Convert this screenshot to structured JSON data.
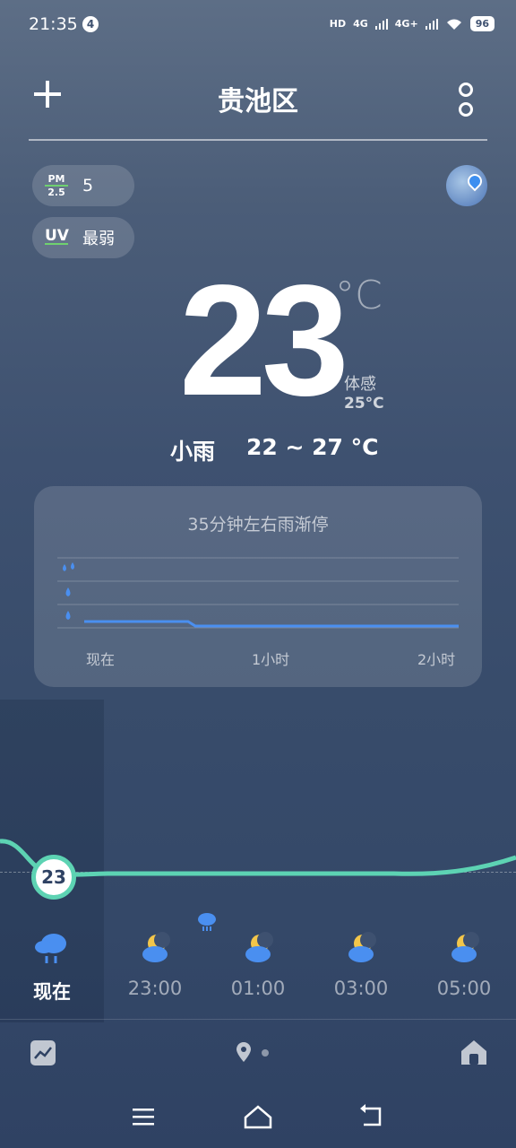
{
  "status_bar": {
    "time": "21:35",
    "notification_count": "4",
    "network_1": "4G",
    "network_2": "4G+",
    "battery": "96"
  },
  "header": {
    "title": "贵池区",
    "add_icon": "plus-icon",
    "menu_icon": "more-vertical-icon"
  },
  "indicators": {
    "pm_label_top": "PM",
    "pm_label_bottom": "2.5",
    "pm_value": "5",
    "uv_label": "UV",
    "uv_value": "最弱"
  },
  "current": {
    "temperature": "23",
    "unit": "°C",
    "feels_like_label": "体感",
    "feels_like_value": "25°C",
    "condition": "小雨",
    "range": "22 ~ 27 °C"
  },
  "precip_card": {
    "title": "35分钟左右雨渐停",
    "x_labels": [
      "现在",
      "1小时",
      "2小时"
    ]
  },
  "chart_data": {
    "type": "line",
    "x": [
      "现在",
      "1小时",
      "2小时"
    ],
    "series": [
      {
        "values": [
          1,
          1,
          0
        ]
      }
    ],
    "ylim": [
      0,
      3
    ],
    "grid": true
  },
  "hourly": {
    "now_temp": "23",
    "items": [
      {
        "label": "现在",
        "icon": "heavy-rain-cloud-icon"
      },
      {
        "label": "23:00",
        "icon": "moon-cloud-icon"
      },
      {
        "label": "01:00",
        "icon": "moon-cloud-icon"
      },
      {
        "label": "03:00",
        "icon": "moon-cloud-icon"
      },
      {
        "label": "05:00",
        "icon": "moon-cloud-icon"
      }
    ]
  },
  "colors": {
    "accent_curve": "#5dd3b3",
    "rain_line": "#4a8ff0",
    "background_top": "#5d6e86",
    "background_bottom": "#2f4263"
  }
}
